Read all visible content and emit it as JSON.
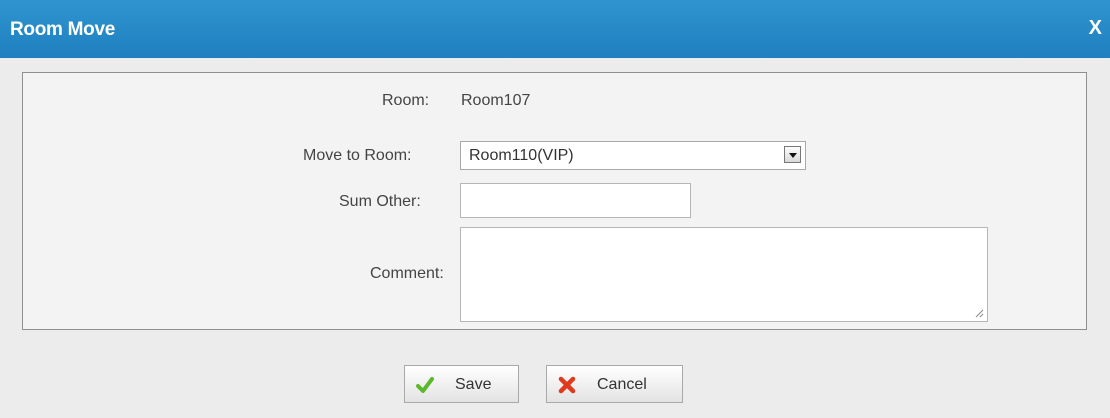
{
  "dialog": {
    "title": "Room Move",
    "close_label": "X"
  },
  "form": {
    "room_label": "Room:",
    "room_value": "Room107",
    "move_to_label": "Move to Room:",
    "move_to_value": "Room110(VIP)",
    "sum_other_label": "Sum Other:",
    "sum_other_value": "",
    "comment_label": "Comment:",
    "comment_value": ""
  },
  "actions": {
    "save_label": "Save",
    "cancel_label": "Cancel"
  },
  "icons": {
    "save": "checkmark-icon",
    "cancel": "x-cross-icon",
    "dropdown": "triangle-down-icon"
  },
  "colors": {
    "titlebar": "#2586c6",
    "save_icon": "#5cb82a",
    "cancel_icon": "#e03a1e"
  }
}
